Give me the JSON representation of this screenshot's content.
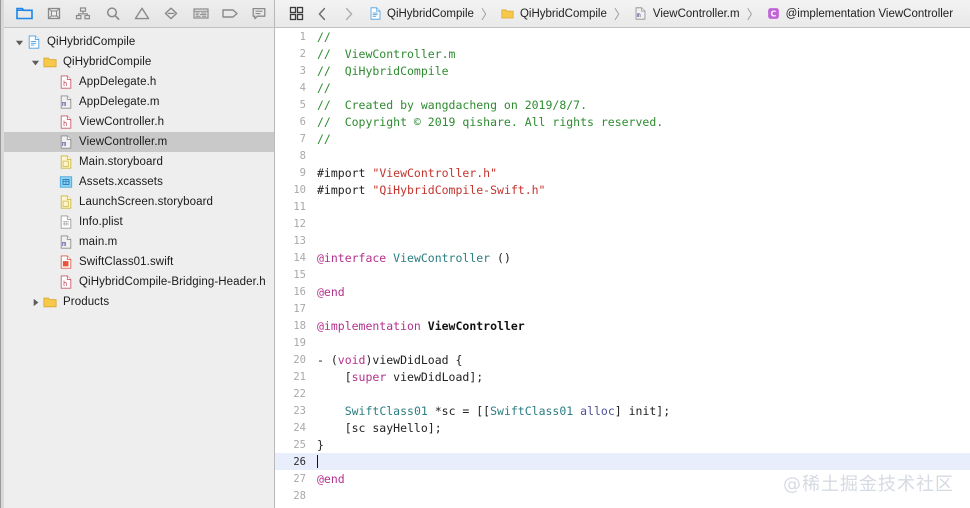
{
  "navigator": {
    "toolbar_icons": [
      {
        "name": "folder-icon",
        "label": "Show the Project navigator",
        "active": true
      },
      {
        "name": "source-control-icon",
        "label": "Show the Source Control navigator",
        "active": false
      },
      {
        "name": "symbol-hierarchy-icon",
        "label": "Show the Symbol navigator",
        "active": false
      },
      {
        "name": "search-icon",
        "label": "Show the Find navigator",
        "active": false
      },
      {
        "name": "warning-triangle-icon",
        "label": "Show the Issue navigator",
        "active": false
      },
      {
        "name": "test-diamond-icon",
        "label": "Show the Test navigator",
        "active": false
      },
      {
        "name": "debug-lines-icon",
        "label": "Show the Debug navigator",
        "active": false
      },
      {
        "name": "breakpoint-tag-icon",
        "label": "Show the Breakpoint navigator",
        "active": false
      },
      {
        "name": "report-bubble-icon",
        "label": "Show the Report navigator",
        "active": false
      }
    ],
    "tree": [
      {
        "label": "QiHybridCompile",
        "icon": "xcode-project-icon",
        "indent": 0,
        "disclosure": "open",
        "selected": false
      },
      {
        "label": "QiHybridCompile",
        "icon": "folder-icon",
        "indent": 1,
        "disclosure": "open",
        "selected": false
      },
      {
        "label": "AppDelegate.h",
        "icon": "header-file-icon",
        "indent": 2,
        "disclosure": "none",
        "selected": false
      },
      {
        "label": "AppDelegate.m",
        "icon": "objc-file-icon",
        "indent": 2,
        "disclosure": "none",
        "selected": false
      },
      {
        "label": "ViewController.h",
        "icon": "header-file-icon",
        "indent": 2,
        "disclosure": "none",
        "selected": false
      },
      {
        "label": "ViewController.m",
        "icon": "objc-file-icon",
        "indent": 2,
        "disclosure": "none",
        "selected": true
      },
      {
        "label": "Main.storyboard",
        "icon": "storyboard-file-icon",
        "indent": 2,
        "disclosure": "none",
        "selected": false
      },
      {
        "label": "Assets.xcassets",
        "icon": "assets-catalog-icon",
        "indent": 2,
        "disclosure": "none",
        "selected": false
      },
      {
        "label": "LaunchScreen.storyboard",
        "icon": "storyboard-file-icon",
        "indent": 2,
        "disclosure": "none",
        "selected": false
      },
      {
        "label": "Info.plist",
        "icon": "plist-file-icon",
        "indent": 2,
        "disclosure": "none",
        "selected": false
      },
      {
        "label": "main.m",
        "icon": "objc-file-icon",
        "indent": 2,
        "disclosure": "none",
        "selected": false
      },
      {
        "label": "SwiftClass01.swift",
        "icon": "swift-file-icon",
        "indent": 2,
        "disclosure": "none",
        "selected": false
      },
      {
        "label": "QiHybridCompile-Bridging-Header.h",
        "icon": "header-file-icon",
        "indent": 2,
        "disclosure": "none",
        "selected": false
      },
      {
        "label": "Products",
        "icon": "folder-icon",
        "indent": 1,
        "disclosure": "closed",
        "selected": false
      }
    ]
  },
  "jump_bar": {
    "related_items_icon": "grid-squares-icon",
    "back_icon": "chevron-left-icon",
    "forward_icon": "chevron-right-icon",
    "separator": "〉",
    "breadcrumbs": [
      {
        "label": "QiHybridCompile",
        "icon": "xcode-project-icon"
      },
      {
        "label": "QiHybridCompile",
        "icon": "folder-icon"
      },
      {
        "label": "ViewController.m",
        "icon": "objc-file-icon"
      },
      {
        "label": "@implementation ViewController",
        "icon": "class-symbol-icon"
      }
    ]
  },
  "editor": {
    "current_line": 26,
    "watermark": "@稀土掘金技术社区",
    "lines": [
      {
        "n": 1,
        "tokens": [
          {
            "t": "//",
            "c": "cmt"
          }
        ]
      },
      {
        "n": 2,
        "tokens": [
          {
            "t": "//  ViewController.m",
            "c": "cmt"
          }
        ]
      },
      {
        "n": 3,
        "tokens": [
          {
            "t": "//  QiHybridCompile",
            "c": "cmt"
          }
        ]
      },
      {
        "n": 4,
        "tokens": [
          {
            "t": "//",
            "c": "cmt"
          }
        ]
      },
      {
        "n": 5,
        "tokens": [
          {
            "t": "//  Created by wangdacheng on 2019/8/7.",
            "c": "cmt"
          }
        ]
      },
      {
        "n": 6,
        "tokens": [
          {
            "t": "//  Copyright © 2019 qishare. All rights reserved.",
            "c": "cmt"
          }
        ]
      },
      {
        "n": 7,
        "tokens": [
          {
            "t": "//",
            "c": "cmt"
          }
        ]
      },
      {
        "n": 8,
        "tokens": []
      },
      {
        "n": 9,
        "tokens": [
          {
            "t": "#import ",
            "c": "pre"
          },
          {
            "t": "\"ViewController.h\"",
            "c": "str"
          }
        ]
      },
      {
        "n": 10,
        "tokens": [
          {
            "t": "#import ",
            "c": "pre"
          },
          {
            "t": "\"QiHybridCompile-Swift.h\"",
            "c": "str"
          }
        ]
      },
      {
        "n": 11,
        "tokens": []
      },
      {
        "n": 12,
        "tokens": []
      },
      {
        "n": 13,
        "tokens": []
      },
      {
        "n": 14,
        "tokens": [
          {
            "t": "@interface ",
            "c": "kw"
          },
          {
            "t": "ViewController",
            "c": "cls"
          },
          {
            "t": " ()",
            "c": "pre"
          }
        ]
      },
      {
        "n": 15,
        "tokens": []
      },
      {
        "n": 16,
        "tokens": [
          {
            "t": "@end",
            "c": "kw"
          }
        ]
      },
      {
        "n": 17,
        "tokens": []
      },
      {
        "n": 18,
        "tokens": [
          {
            "t": "@implementation ",
            "c": "kw"
          },
          {
            "t": "ViewController",
            "c": "bold"
          }
        ]
      },
      {
        "n": 19,
        "tokens": []
      },
      {
        "n": 20,
        "tokens": [
          {
            "t": "- (",
            "c": "pre"
          },
          {
            "t": "void",
            "c": "kw"
          },
          {
            "t": ")viewDidLoad {",
            "c": "pre"
          }
        ]
      },
      {
        "n": 21,
        "tokens": [
          {
            "t": "    [",
            "c": "pre"
          },
          {
            "t": "super",
            "c": "kw"
          },
          {
            "t": " viewDidLoad];",
            "c": "pre"
          }
        ]
      },
      {
        "n": 22,
        "tokens": []
      },
      {
        "n": 23,
        "tokens": [
          {
            "t": "    ",
            "c": "pre"
          },
          {
            "t": "SwiftClass01",
            "c": "cls"
          },
          {
            "t": " *sc = [[",
            "c": "pre"
          },
          {
            "t": "SwiftClass01",
            "c": "cls"
          },
          {
            "t": " ",
            "c": "pre"
          },
          {
            "t": "alloc",
            "c": "meth"
          },
          {
            "t": "] init];",
            "c": "pre"
          }
        ]
      },
      {
        "n": 24,
        "tokens": [
          {
            "t": "    [sc sayHello];",
            "c": "pre"
          }
        ]
      },
      {
        "n": 25,
        "tokens": [
          {
            "t": "}",
            "c": "pre"
          }
        ]
      },
      {
        "n": 26,
        "tokens": []
      },
      {
        "n": 27,
        "tokens": [
          {
            "t": "@end",
            "c": "kw"
          }
        ]
      },
      {
        "n": 28,
        "tokens": []
      }
    ]
  },
  "colors": {
    "comment": "#2e8b30",
    "keyword": "#b4308c",
    "string": "#c3332c",
    "class": "#2b7d81",
    "method": "#50519b",
    "current_line_bg": "#e8eefb",
    "selection_bg": "#c9c9c9",
    "sidebar_bg": "#eeeeee"
  }
}
